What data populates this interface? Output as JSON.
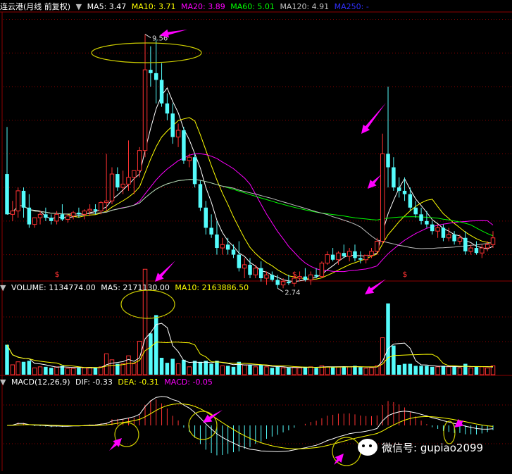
{
  "colors": {
    "up": "#ff3232",
    "down": "#54fcfc",
    "ma5": "#ffffff",
    "ma10": "#ffff00",
    "ma20": "#ff00ff",
    "ma60": "#00ff00",
    "ma120": "#c0c0c0",
    "ma250": "#0000ff",
    "grid": "#8b0000",
    "annot": "#ff00ff",
    "ellipse": "#cccc00"
  },
  "main_legend": {
    "title": "连云港(月线 前复权)",
    "ma5": "MA5: 3.47",
    "ma10": "MA10: 3.71",
    "ma20": "MA20: 3.89",
    "ma60": "MA60: 5.01",
    "ma120": "MA120: 4.91",
    "ma250": "MA250: -"
  },
  "vol_legend": {
    "vol": "VOLUME: 1134774.00",
    "ma5": "MA5: 2171130.00",
    "ma10": "MA10: 2163886.50"
  },
  "macd_legend": {
    "name": "MACD(12,26,9)",
    "dif": "DIF: -0.33",
    "dea": "DEA: -0.31",
    "macd": "MACD: -0.05"
  },
  "watermark": "微信号: gupiao2099",
  "chart_data": [
    {
      "type": "candlestick",
      "title": "连云港(月线 前复权)",
      "ylim": [
        2.3,
        10.2
      ],
      "high_label": "9.56",
      "low_label": "2.74",
      "dividend_marker": "$",
      "dividend_bars": [
        9,
        52,
        72,
        92
      ],
      "candles": [
        {
          "o": 5.4,
          "h": 6.8,
          "l": 4.2,
          "c": 4.2
        },
        {
          "o": 4.2,
          "h": 4.6,
          "l": 4.0,
          "c": 4.3
        },
        {
          "o": 4.3,
          "h": 5.0,
          "l": 4.1,
          "c": 4.9
        },
        {
          "o": 4.9,
          "h": 5.0,
          "l": 4.1,
          "c": 4.4
        },
        {
          "o": 4.4,
          "h": 4.8,
          "l": 3.8,
          "c": 3.9
        },
        {
          "o": 3.9,
          "h": 4.1,
          "l": 3.8,
          "c": 4.1
        },
        {
          "o": 4.1,
          "h": 4.3,
          "l": 3.9,
          "c": 4.2
        },
        {
          "o": 4.2,
          "h": 4.4,
          "l": 4.0,
          "c": 4.1
        },
        {
          "o": 4.1,
          "h": 4.2,
          "l": 3.9,
          "c": 4.0
        },
        {
          "o": 4.0,
          "h": 4.3,
          "l": 3.9,
          "c": 4.2
        },
        {
          "o": 4.2,
          "h": 4.5,
          "l": 4.0,
          "c": 4.05
        },
        {
          "o": 4.05,
          "h": 4.2,
          "l": 3.95,
          "c": 4.15
        },
        {
          "o": 4.15,
          "h": 4.3,
          "l": 4.05,
          "c": 4.25
        },
        {
          "o": 4.25,
          "h": 4.4,
          "l": 4.1,
          "c": 4.2
        },
        {
          "o": 4.2,
          "h": 4.35,
          "l": 4.05,
          "c": 4.3
        },
        {
          "o": 4.3,
          "h": 4.5,
          "l": 4.15,
          "c": 4.35
        },
        {
          "o": 4.35,
          "h": 4.5,
          "l": 4.2,
          "c": 4.3
        },
        {
          "o": 4.3,
          "h": 4.6,
          "l": 4.2,
          "c": 4.55
        },
        {
          "o": 4.55,
          "h": 6.0,
          "l": 4.3,
          "c": 4.6
        },
        {
          "o": 4.6,
          "h": 5.6,
          "l": 4.5,
          "c": 5.4
        },
        {
          "o": 5.4,
          "h": 5.6,
          "l": 4.9,
          "c": 5.0
        },
        {
          "o": 5.0,
          "h": 5.5,
          "l": 4.8,
          "c": 5.1
        },
        {
          "o": 5.1,
          "h": 6.4,
          "l": 4.9,
          "c": 5.3
        },
        {
          "o": 5.3,
          "h": 5.5,
          "l": 4.8,
          "c": 5.5
        },
        {
          "o": 5.5,
          "h": 6.2,
          "l": 5.3,
          "c": 6.1
        },
        {
          "o": 6.1,
          "h": 9.56,
          "l": 5.9,
          "c": 8.5
        },
        {
          "o": 8.5,
          "h": 9.2,
          "l": 8.0,
          "c": 8.4
        },
        {
          "o": 8.4,
          "h": 9.4,
          "l": 7.5,
          "c": 8.2
        },
        {
          "o": 8.2,
          "h": 8.7,
          "l": 7.4,
          "c": 7.5
        },
        {
          "o": 7.5,
          "h": 7.8,
          "l": 7.0,
          "c": 7.2
        },
        {
          "o": 7.2,
          "h": 7.5,
          "l": 6.3,
          "c": 6.5
        },
        {
          "o": 6.5,
          "h": 6.9,
          "l": 6.2,
          "c": 6.7
        },
        {
          "o": 6.7,
          "h": 6.8,
          "l": 5.7,
          "c": 5.8
        },
        {
          "o": 5.8,
          "h": 6.0,
          "l": 5.6,
          "c": 5.9
        },
        {
          "o": 5.9,
          "h": 6.0,
          "l": 5.0,
          "c": 5.1
        },
        {
          "o": 5.1,
          "h": 5.2,
          "l": 4.3,
          "c": 4.4
        },
        {
          "o": 4.4,
          "h": 4.6,
          "l": 3.6,
          "c": 3.8
        },
        {
          "o": 3.8,
          "h": 4.2,
          "l": 3.5,
          "c": 3.6
        },
        {
          "o": 3.6,
          "h": 4.0,
          "l": 3.0,
          "c": 3.2
        },
        {
          "o": 3.2,
          "h": 3.5,
          "l": 3.0,
          "c": 3.3
        },
        {
          "o": 3.3,
          "h": 3.5,
          "l": 3.0,
          "c": 3.15
        },
        {
          "o": 3.15,
          "h": 3.3,
          "l": 2.9,
          "c": 3.0
        },
        {
          "o": 3.0,
          "h": 3.4,
          "l": 2.5,
          "c": 2.6
        },
        {
          "o": 2.6,
          "h": 2.9,
          "l": 2.3,
          "c": 2.7
        },
        {
          "o": 2.7,
          "h": 2.9,
          "l": 2.3,
          "c": 2.4
        },
        {
          "o": 2.4,
          "h": 2.7,
          "l": 2.3,
          "c": 2.6
        },
        {
          "o": 2.6,
          "h": 2.8,
          "l": 2.2,
          "c": 2.3
        },
        {
          "o": 2.3,
          "h": 2.5,
          "l": 2.1,
          "c": 2.4
        },
        {
          "o": 2.4,
          "h": 2.5,
          "l": 2.2,
          "c": 2.25
        },
        {
          "o": 2.25,
          "h": 2.4,
          "l": 2.0,
          "c": 2.1
        },
        {
          "o": 2.1,
          "h": 2.3,
          "l": 2.0,
          "c": 2.2
        },
        {
          "o": 2.2,
          "h": 2.4,
          "l": 2.1,
          "c": 2.15
        },
        {
          "o": 2.15,
          "h": 2.4,
          "l": 2.05,
          "c": 2.3
        },
        {
          "o": 2.3,
          "h": 2.5,
          "l": 2.2,
          "c": 2.35
        },
        {
          "o": 2.35,
          "h": 2.6,
          "l": 2.2,
          "c": 2.25
        },
        {
          "o": 2.25,
          "h": 2.5,
          "l": 2.1,
          "c": 2.4
        },
        {
          "o": 2.4,
          "h": 2.6,
          "l": 2.3,
          "c": 2.35
        },
        {
          "o": 2.35,
          "h": 2.8,
          "l": 2.3,
          "c": 2.75
        },
        {
          "o": 2.75,
          "h": 3.1,
          "l": 2.7,
          "c": 3.0
        },
        {
          "o": 3.0,
          "h": 3.2,
          "l": 2.8,
          "c": 2.85
        },
        {
          "o": 2.85,
          "h": 3.1,
          "l": 2.7,
          "c": 3.05
        },
        {
          "o": 3.05,
          "h": 3.3,
          "l": 2.9,
          "c": 2.95
        },
        {
          "o": 2.95,
          "h": 3.2,
          "l": 2.8,
          "c": 3.1
        },
        {
          "o": 3.1,
          "h": 3.3,
          "l": 2.8,
          "c": 2.9
        },
        {
          "o": 2.9,
          "h": 3.1,
          "l": 2.74,
          "c": 2.85
        },
        {
          "o": 2.85,
          "h": 3.0,
          "l": 2.74,
          "c": 2.98
        },
        {
          "o": 2.98,
          "h": 3.2,
          "l": 2.9,
          "c": 3.1
        },
        {
          "o": 3.1,
          "h": 3.5,
          "l": 3.0,
          "c": 3.4
        },
        {
          "o": 3.4,
          "h": 6.6,
          "l": 3.3,
          "c": 6.0
        },
        {
          "o": 6.0,
          "h": 8.0,
          "l": 5.0,
          "c": 5.6
        },
        {
          "o": 5.6,
          "h": 5.9,
          "l": 4.9,
          "c": 5.0
        },
        {
          "o": 5.0,
          "h": 5.3,
          "l": 4.7,
          "c": 4.9
        },
        {
          "o": 4.9,
          "h": 5.3,
          "l": 4.6,
          "c": 4.8
        },
        {
          "o": 4.8,
          "h": 5.0,
          "l": 4.3,
          "c": 4.4
        },
        {
          "o": 4.4,
          "h": 4.6,
          "l": 4.1,
          "c": 4.2
        },
        {
          "o": 4.2,
          "h": 4.4,
          "l": 3.9,
          "c": 4.0
        },
        {
          "o": 4.0,
          "h": 4.3,
          "l": 3.8,
          "c": 3.9
        },
        {
          "o": 3.9,
          "h": 4.0,
          "l": 3.6,
          "c": 3.7
        },
        {
          "o": 3.7,
          "h": 3.9,
          "l": 3.5,
          "c": 3.8
        },
        {
          "o": 3.8,
          "h": 3.9,
          "l": 3.4,
          "c": 3.5
        },
        {
          "o": 3.5,
          "h": 3.8,
          "l": 3.4,
          "c": 3.6
        },
        {
          "o": 3.6,
          "h": 3.7,
          "l": 3.3,
          "c": 3.4
        },
        {
          "o": 3.4,
          "h": 3.6,
          "l": 3.3,
          "c": 3.5
        },
        {
          "o": 3.5,
          "h": 3.7,
          "l": 3.0,
          "c": 3.1
        },
        {
          "o": 3.1,
          "h": 3.3,
          "l": 3.0,
          "c": 3.2
        },
        {
          "o": 3.2,
          "h": 3.4,
          "l": 3.0,
          "c": 3.05
        },
        {
          "o": 3.05,
          "h": 3.3,
          "l": 2.9,
          "c": 3.2
        },
        {
          "o": 3.2,
          "h": 3.4,
          "l": 3.1,
          "c": 3.3
        },
        {
          "o": 3.3,
          "h": 3.7,
          "l": 3.2,
          "c": 3.5
        }
      ]
    },
    {
      "type": "bar",
      "title": "VOLUME",
      "ylim": [
        0,
        4200000
      ]
    },
    {
      "type": "bar",
      "title": "MACD(12,26,9)",
      "ylim": [
        -1.2,
        1.2
      ]
    }
  ]
}
